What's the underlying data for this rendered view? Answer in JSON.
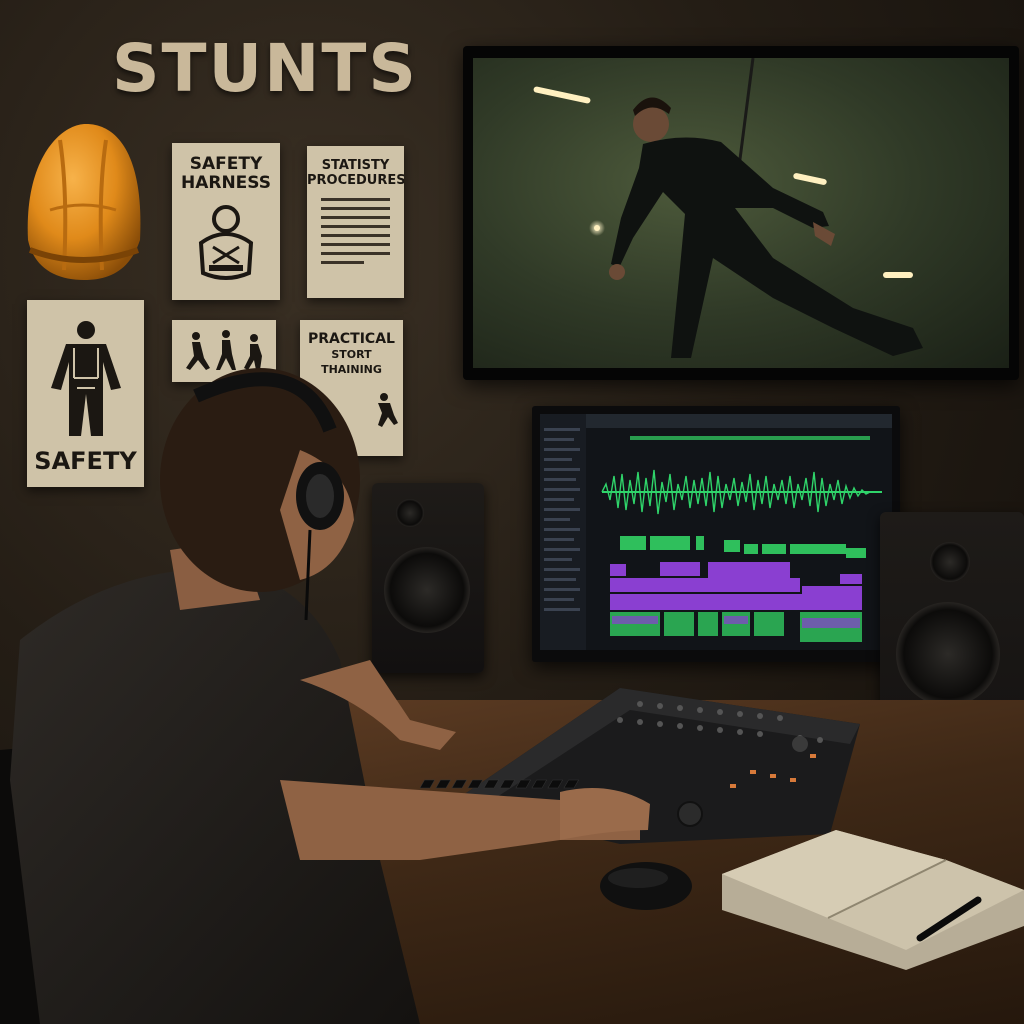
{
  "wall": {
    "title": "STUNTS"
  },
  "posters": {
    "harness": {
      "line1": "SAFETY",
      "line2": "HARNESS"
    },
    "procedures": {
      "line1": "STATISTY",
      "line2": "PROCEDURES"
    },
    "suit": {
      "label": "SAFETY"
    },
    "training": {
      "line1": "PRACTICAL",
      "line2": "STORT THAINING"
    }
  },
  "icons": {
    "helmet": "hard-hat-icon",
    "harness": "harness-icon",
    "suit": "safety-suit-icon",
    "figures": "stunt-figures-icon"
  },
  "colors": {
    "waveform": "#2fd46a",
    "clip_green": "#2fbf5c",
    "clip_purple": "#8a3fd1",
    "helmet": "#e08a1a",
    "poster": "#cfc3a8"
  }
}
